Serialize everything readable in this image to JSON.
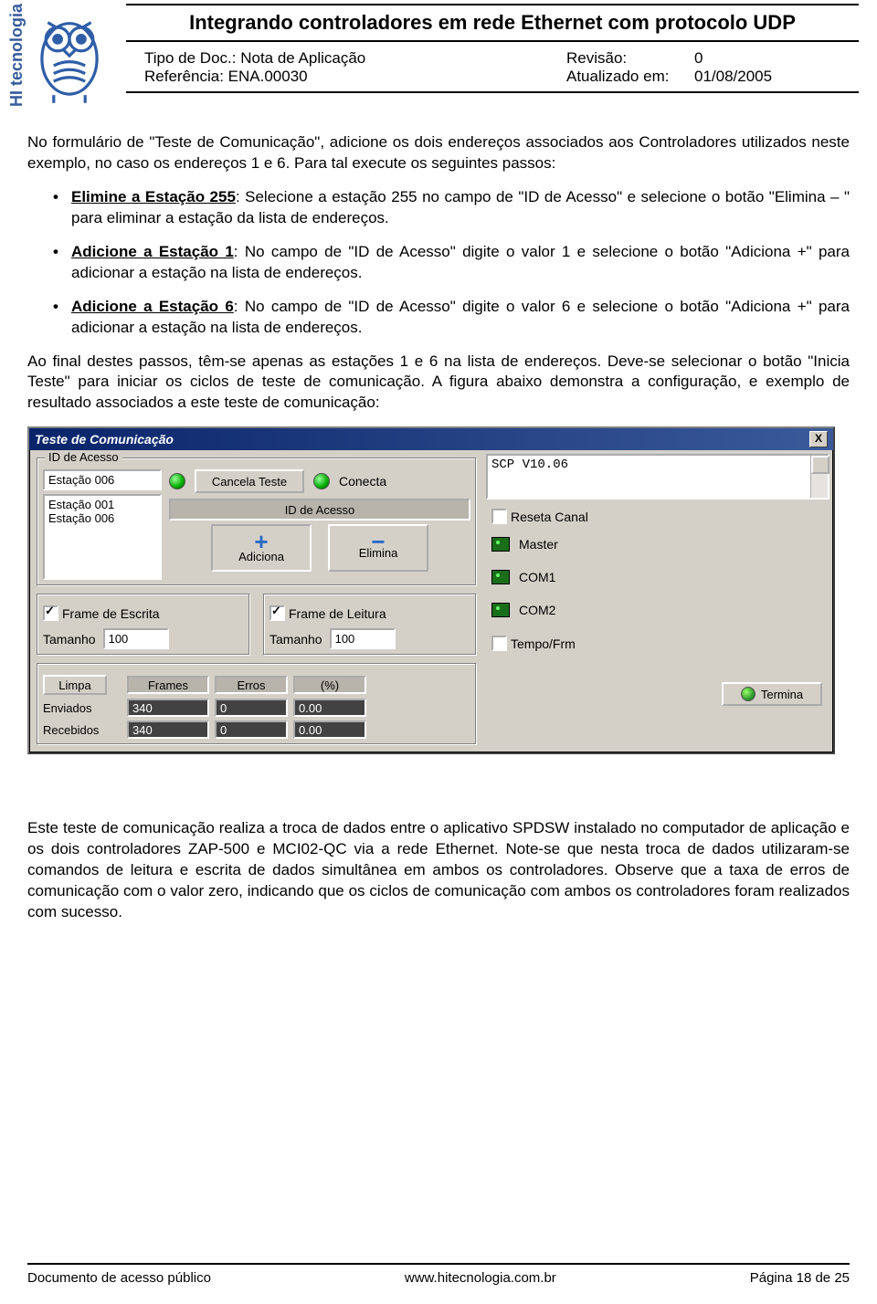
{
  "header": {
    "brand_vertical": "HI tecnologia",
    "title": "Integrando controladores em rede Ethernet com protocolo UDP",
    "doc_type_label": "Tipo de Doc.:",
    "doc_type_value": "Nota de Aplicação",
    "ref_label": "Referência:",
    "ref_value": "ENA.00030",
    "rev_label": "Revisão:",
    "rev_value": "0",
    "upd_label": "Atualizado em:",
    "upd_value": "01/08/2005"
  },
  "body": {
    "p1": "No formulário de \"Teste de Comunicação\", adicione os dois endereços associados aos Controladores utilizados neste exemplo, no caso os endereços 1 e 6. Para tal execute os seguintes passos:",
    "b1_u": "Elimine a Estação 255",
    "b1_t": ": Selecione a estação 255 no campo de \"ID de Acesso\" e selecione o botão \"Elimina – \" para eliminar a estação da lista de endereços.",
    "b2_u": "Adicione a Estação 1",
    "b2_t": ": No campo de \"ID de Acesso\" digite o valor 1 e selecione o botão \"Adiciona +\" para adicionar a estação na lista de endereços.",
    "b3_u": "Adicione a Estação 6",
    "b3_t": ": No campo de \"ID de Acesso\" digite o valor 6 e selecione o botão \"Adiciona +\" para adicionar a estação na lista de endereços.",
    "p2": "Ao final destes passos, têm-se apenas as estações 1 e 6 na lista de endereços. Deve-se selecionar o botão \"Inicia Teste\" para iniciar os ciclos de teste de comunicação. A figura abaixo demonstra a configuração, e exemplo de resultado associados a este teste de comunicação:",
    "p3": "Este teste de comunicação realiza a troca de dados entre o aplicativo SPDSW instalado no computador de aplicação e os dois controladores ZAP-500 e MCI02-QC via a rede Ethernet. Note-se que nesta troca de dados utilizaram-se comandos de leitura e escrita de dados simultânea em ambos os controladores. Observe que a taxa de erros de comunicação com o valor zero, indicando que os ciclos de comunicação com ambos os controladores foram realizados com sucesso."
  },
  "dialog": {
    "title": "Teste de Comunicação",
    "close": "X",
    "group_id": "ID de Acesso",
    "id_field": "Estação 006",
    "list": [
      "Estação 001",
      "Estação 006"
    ],
    "cancel": "Cancela Teste",
    "connect": "Conecta",
    "section_id": "ID de Acesso",
    "add": "Adiciona",
    "remove": "Elimina",
    "frame_write": "Frame de Escrita",
    "frame_read": "Frame de Leitura",
    "size_label": "Tamanho",
    "size_value": "100",
    "btn_clear": "Limpa",
    "hdr_frames": "Frames",
    "hdr_errors": "Erros",
    "hdr_pct": "(%)",
    "row_sent": "Enviados",
    "row_recv": "Recebidos",
    "v_sent_frames": "340",
    "v_sent_err": "0",
    "v_sent_pct": "0.00",
    "v_recv_frames": "340",
    "v_recv_err": "0",
    "v_recv_pct": "0.00",
    "log_line": "SCP V10.06",
    "reset_canal": "Reseta Canal",
    "master": "Master",
    "com1": "COM1",
    "com2": "COM2",
    "tempo": "Tempo/Frm",
    "terminate": "Termina"
  },
  "footer": {
    "left": "Documento de acesso público",
    "center": "www.hitecnologia.com.br",
    "right": "Página 18 de 25"
  }
}
